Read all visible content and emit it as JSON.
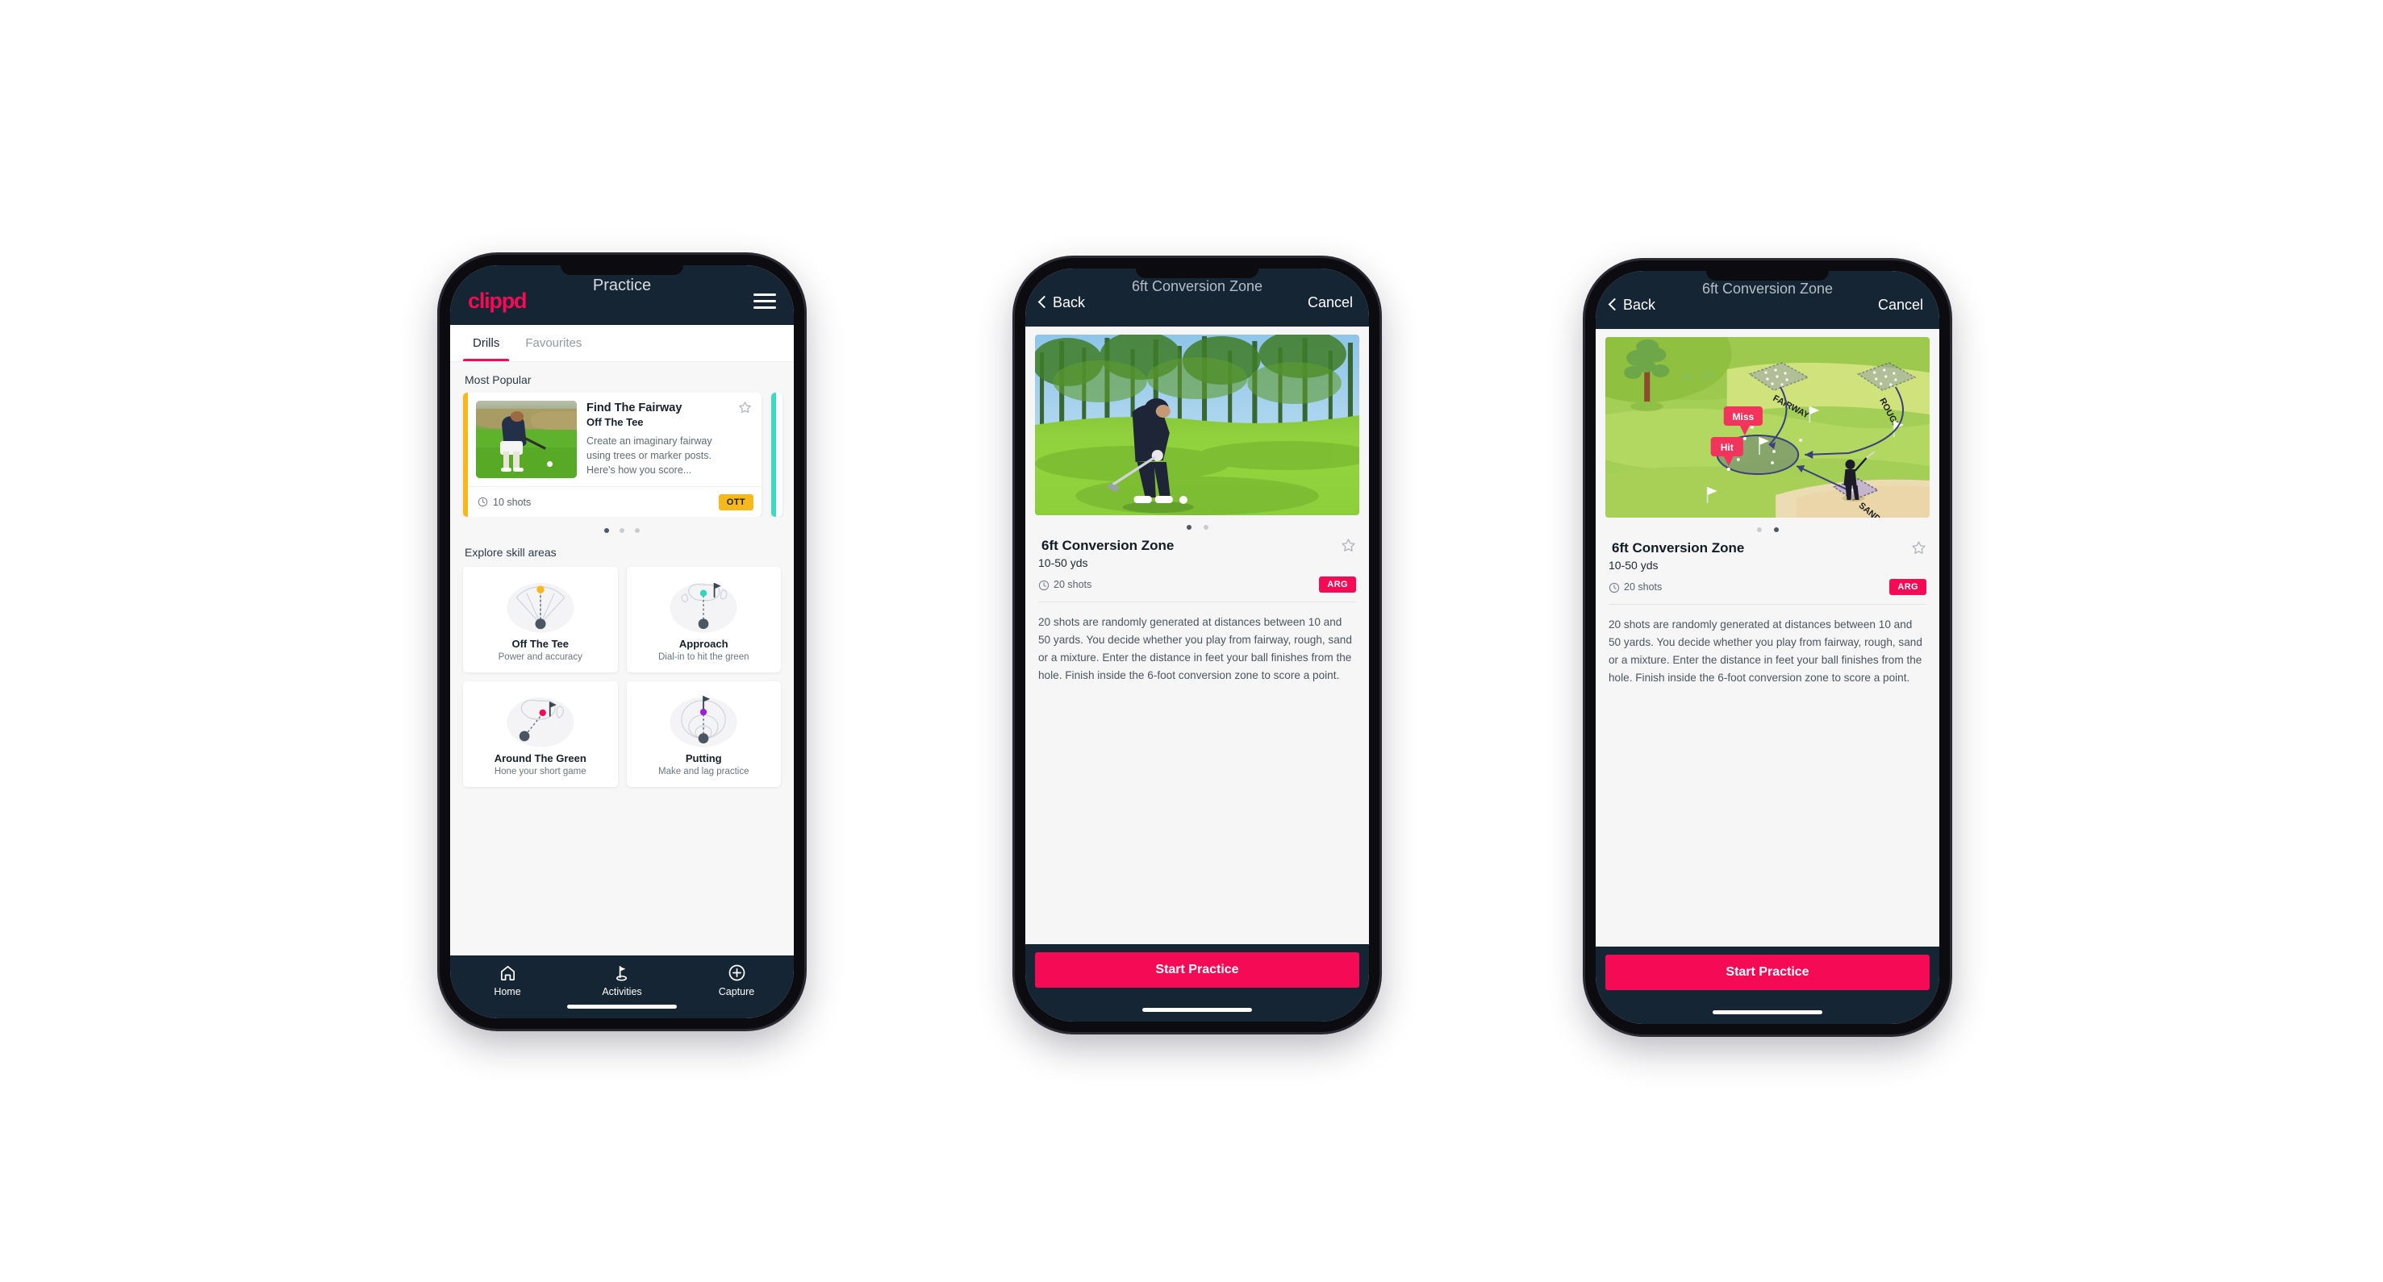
{
  "phone1": {
    "appbar": {
      "logo": "clippd",
      "title": "Practice",
      "menu_icon": "hamburger-menu-icon"
    },
    "tabs": [
      {
        "label": "Drills",
        "active": true
      },
      {
        "label": "Favourites",
        "active": false
      }
    ],
    "most_popular": {
      "section_title": "Most Popular",
      "card": {
        "title": "Find The Fairway",
        "subtitle": "Off The Tee",
        "description": "Create an imaginary fairway using trees or marker posts. Here's how you score...",
        "shots": "10 shots",
        "badge": "OTT",
        "badge_color": "#f6b81b",
        "accent_color": "#f6b81b",
        "next_card_accent": "#3ddac3",
        "star_icon": "star-outline-icon",
        "clock_icon": "clock-icon"
      },
      "dots": [
        true,
        false,
        false
      ]
    },
    "skills": {
      "section_title": "Explore skill areas",
      "items": [
        {
          "name": "Off The Tee",
          "desc": "Power and accuracy",
          "art": "tee-dispersion-icon",
          "dot_color": "#f6b81b"
        },
        {
          "name": "Approach",
          "desc": "Dial-in to hit the green",
          "art": "green-approach-icon",
          "dot_color": "#2fd6b8"
        },
        {
          "name": "Around The Green",
          "desc": "Hone your short game",
          "art": "chip-around-green-icon",
          "dot_color": "#f50b55"
        },
        {
          "name": "Putting",
          "desc": "Make and lag practice",
          "art": "putting-rings-icon",
          "dot_color": "#9b22d6"
        }
      ]
    },
    "bottom_nav": [
      {
        "label": "Home",
        "icon": "home-icon",
        "active": false
      },
      {
        "label": "Activities",
        "icon": "golf-flag-icon",
        "active": true
      },
      {
        "label": "Capture",
        "icon": "plus-circle-icon",
        "active": false
      }
    ]
  },
  "detail": {
    "back_label": "Back",
    "title": "6ft Conversion Zone",
    "cancel_label": "Cancel",
    "back_icon": "chevron-left-icon",
    "drill_title": "6ft Conversion Zone",
    "drill_distance": "10-50 yds",
    "shots": "20 shots",
    "badge": "ARG",
    "badge_color": "#f50b55",
    "star_icon": "star-outline-icon",
    "clock_icon": "clock-icon",
    "description": "20 shots are randomly generated at distances between 10 and 50 yards. You decide whether you play from fairway, rough, sand or a mixture. Enter the distance in feet your ball finishes from the hole. Finish inside the 6-foot conversion zone to score a point.",
    "cta_label": "Start Practice"
  },
  "phone2": {
    "media_type": "golfer-chipping-photo",
    "dots": [
      true,
      false
    ]
  },
  "phone3": {
    "media_type": "course-diagram-illustration",
    "dots": [
      false,
      true
    ],
    "diagram_labels": {
      "fairway": "FAIRWAY",
      "rough": "ROUGH",
      "sand": "SAND",
      "miss": "Miss",
      "hit": "Hit"
    }
  },
  "theme": {
    "brand_pink": "#f50b55",
    "dark_navy": "#152534",
    "amber": "#f6b81b",
    "teal": "#3ddac3",
    "page_bg": "#ffffff"
  }
}
